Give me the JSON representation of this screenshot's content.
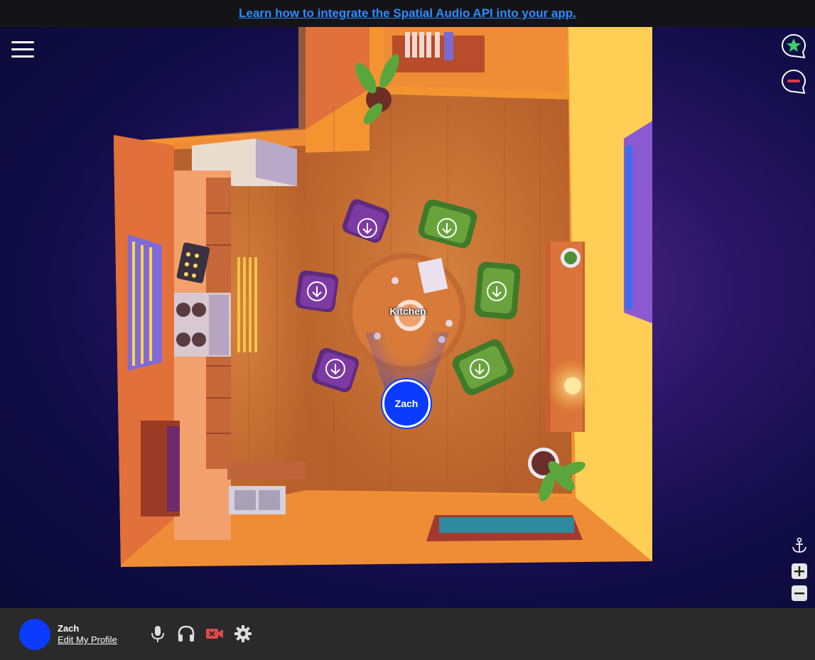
{
  "banner": {
    "link_text": "Learn how to integrate the Spatial Audio API into your app."
  },
  "topright": {
    "favorite_icon": "star-chat-icon",
    "leave_icon": "minus-chat-icon"
  },
  "room": {
    "label": "Kitchen",
    "seats_icon": "arrow-down-circle-icon"
  },
  "user": {
    "avatar_label": "Zach"
  },
  "zoom": {
    "recenter_icon": "anchor-icon",
    "zoom_in_icon": "plus-icon",
    "zoom_out_icon": "minus-icon"
  },
  "bottombar": {
    "name": "Zach",
    "edit_profile": "Edit My Profile",
    "mic_icon": "microphone-icon",
    "headphones_icon": "headphones-icon",
    "video_icon": "video-off-icon",
    "settings_icon": "gear-icon"
  },
  "colors": {
    "avatar": "#0a3bff",
    "link": "#2f8bff",
    "video_off": "#e04848",
    "star": "#3bd16f"
  }
}
